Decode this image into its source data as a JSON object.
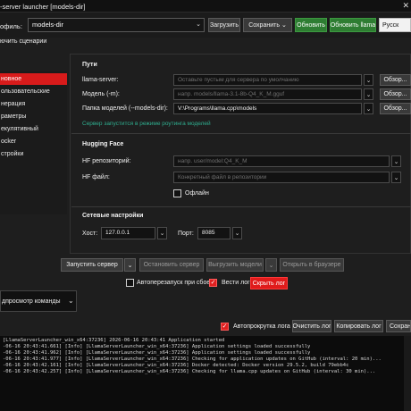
{
  "window": {
    "title": "-server launcher [models-dir]",
    "close": "✕"
  },
  "toolbar": {
    "profile_label": "офиль:",
    "profile_value": "models-dir",
    "load": "Загрузить",
    "save": "Сохранить",
    "update": "Обновить",
    "update_llama": "Обновить llama",
    "language": "Русск"
  },
  "scenarios_label": "ючить сценарии",
  "sidebar": {
    "items": [
      {
        "label": "новное"
      },
      {
        "label": "ользовательские"
      },
      {
        "label": "нерация"
      },
      {
        "label": "раметры"
      },
      {
        "label": "екулятивный"
      },
      {
        "label": "ocker"
      },
      {
        "label": "стройки"
      }
    ]
  },
  "paths": {
    "title": "Пути",
    "server_label": "llama-server:",
    "server_placeholder": "Оставьте пустым для сервера по умолчанию",
    "model_label": "Модель (-m):",
    "model_placeholder": "напр. models/llama-3.1-8b-Q4_K_M.gguf",
    "models_dir_label": "Папка моделей (--models-dir):",
    "models_dir_value": "V:\\Programs\\llama.cpp\\models",
    "browse": "Обзор...",
    "router_hint": "Сервер запустится в режиме роутинга моделей"
  },
  "hf": {
    "title": "Hugging Face",
    "repo_label": "HF репозиторий:",
    "repo_placeholder": "напр. user/model:Q4_K_M",
    "file_label": "HF файл:",
    "file_placeholder": "Конкретный файл в репозитории",
    "offline_label": "Офлайн"
  },
  "network": {
    "title": "Сетевые настройки",
    "host_label": "Хост:",
    "host_value": "127.0.0.1",
    "port_label": "Порт:",
    "port_value": "8085"
  },
  "actions": {
    "start_server": "Запустить сервер",
    "stop_server": "Остановить сервер",
    "unload_model": "Выгрузить модели",
    "open_browser": "Открыть в браузере",
    "autorestart_label": "Автоперезапуск при сбое",
    "keep_log_label": "Вести лог",
    "hide_log": "Скрыть лог"
  },
  "preview": {
    "label": "дпросмотр команды"
  },
  "log_toolbar": {
    "autoscroll_label": "Автопрокрутка лога",
    "clear": "Очистить лог",
    "copy": "Копировать лог",
    "save": "Сохран"
  },
  "log_lines": [
    "[LlamaServerLauncher_win_x64:37236] 2026-06-16 20:43:41 Application started",
    "-06-16 20:43:41.661] [Info] [LlamaServerLauncher_win_x64:37236] Application settings loaded successfully",
    "-06-16 20:43:41.962] [Info] [LlamaServerLauncher_win_x64:37236] Application settings loaded successfully",
    "-06-16 20:43:41.977] [Info] [LlamaServerLauncher_win_x64:37236] Checking for application updates on GitHub (interval: 20 min)...",
    "-06-16 20:43:42.161] [Info] [LlamaServerLauncher_win_x64:37236] Docker detected: Docker version 29.5.2, build 79ebb4c",
    "-06-16 20:43:42.257] [Info] [LlamaServerLauncher_win_x64:37236] Checking for llama.cpp updates on GitHub (interval: 30 min)..."
  ],
  "icons": {
    "chevron": "chevron-down-icon",
    "check": "check-icon"
  },
  "colors": {
    "accent_red": "#d81b1b",
    "green": "#2e7d32",
    "hint_teal": "#2fae8f"
  }
}
